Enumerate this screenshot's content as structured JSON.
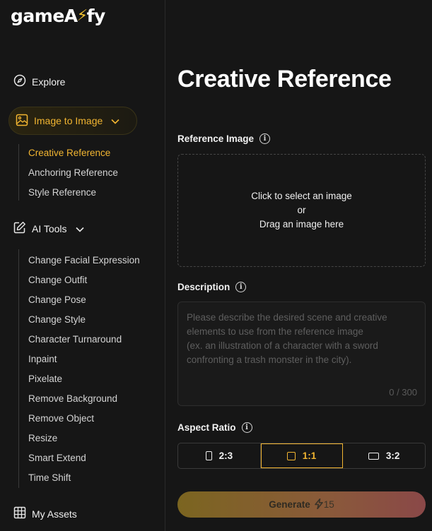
{
  "brand": {
    "logo_text_before": "gameA",
    "logo_text_after": "fy",
    "logo_accent": "#f2c230"
  },
  "sidebar": {
    "explore_label": "Explore",
    "image_to_image": {
      "label": "Image to Image",
      "items": [
        {
          "label": "Creative Reference",
          "active": true
        },
        {
          "label": "Anchoring Reference",
          "active": false
        },
        {
          "label": "Style Reference",
          "active": false
        }
      ]
    },
    "ai_tools": {
      "label": "AI Tools",
      "items": [
        {
          "label": "Change Facial Expression"
        },
        {
          "label": "Change Outfit"
        },
        {
          "label": "Change Pose"
        },
        {
          "label": "Change Style"
        },
        {
          "label": "Character Turnaround"
        },
        {
          "label": "Inpaint"
        },
        {
          "label": "Pixelate"
        },
        {
          "label": "Remove Background"
        },
        {
          "label": "Remove Object"
        },
        {
          "label": "Resize"
        },
        {
          "label": "Smart Extend"
        },
        {
          "label": "Time Shift"
        }
      ]
    },
    "my_assets_label": "My Assets"
  },
  "main": {
    "title": "Creative Reference",
    "reference_image": {
      "label": "Reference Image",
      "drop_line1": "Click to select an image",
      "drop_line2": "or",
      "drop_line3": "Drag an image here"
    },
    "description": {
      "label": "Description",
      "placeholder": "Please describe the desired scene and creative elements to use from the reference image\n(ex. an illustration of a character with a sword confronting a trash monster in the city).",
      "value": "",
      "counter": "0 / 300"
    },
    "aspect_ratio": {
      "label": "Aspect Ratio",
      "options": [
        {
          "label": "2:3",
          "shape": "portrait",
          "selected": false
        },
        {
          "label": "1:1",
          "shape": "square",
          "selected": true
        },
        {
          "label": "3:2",
          "shape": "landscape",
          "selected": false
        }
      ]
    },
    "generate": {
      "label": "Generate",
      "cost": "15"
    }
  },
  "colors": {
    "accent": "#f2b531",
    "background": "#161616"
  }
}
